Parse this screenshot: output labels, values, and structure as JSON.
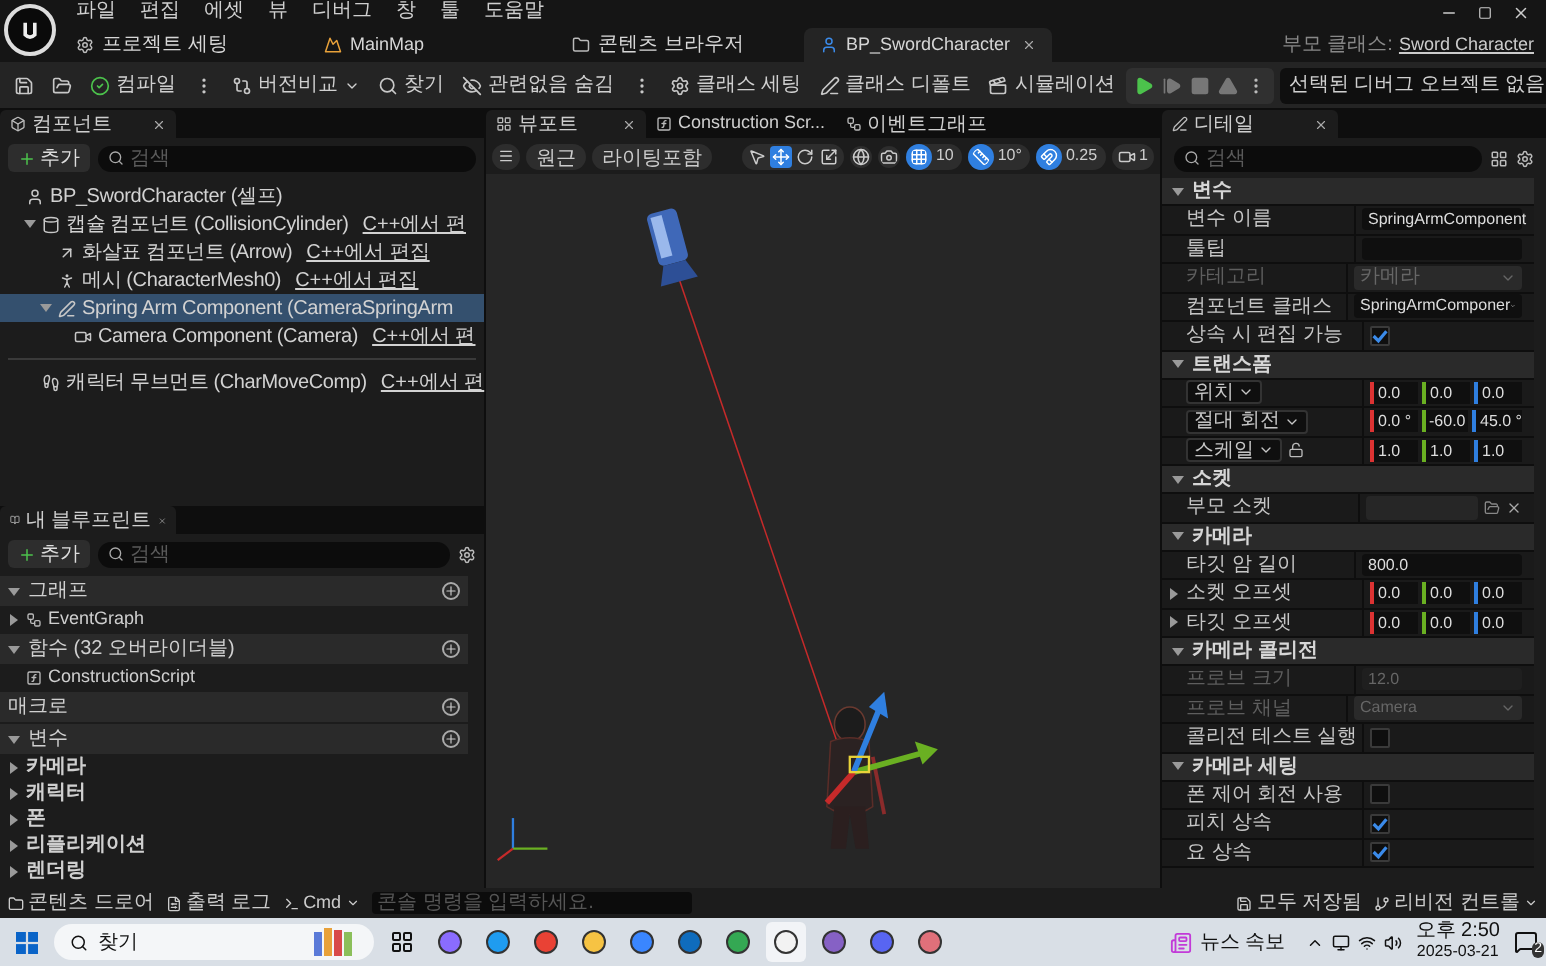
{
  "menu": [
    "파일",
    "편집",
    "에셋",
    "뷰",
    "디버그",
    "창",
    "툴",
    "도움말"
  ],
  "doc_tabs": [
    {
      "label": "프로젝트 세팅",
      "kind": "settings",
      "selected": false,
      "closable": false
    },
    {
      "label": "MainMap",
      "kind": "level",
      "selected": false,
      "closable": false
    },
    {
      "label": "콘텐츠 브라우저",
      "kind": "folder",
      "selected": false,
      "closable": false
    },
    {
      "label": "BP_SwordCharacter",
      "kind": "blueprint",
      "selected": true,
      "closable": true
    }
  ],
  "parent_class": {
    "label": "부모 클래스:",
    "value": "Sword Character"
  },
  "toolbar": [
    {
      "kind": "save"
    },
    {
      "kind": "browse"
    },
    {
      "kind": "compile",
      "label": "컴파일"
    },
    {
      "kind": "more"
    },
    {
      "kind": "diff",
      "label": "버전비교"
    },
    {
      "kind": "find",
      "label": "찾기"
    },
    {
      "kind": "hide",
      "label": "관련없음 숨김"
    },
    {
      "kind": "more"
    },
    {
      "kind": "settings",
      "label": "클래스 세팅"
    },
    {
      "kind": "defaults",
      "label": "클래스 디폴트"
    },
    {
      "kind": "simulate",
      "label": "시뮬레이션"
    }
  ],
  "play_controls": [
    {
      "kind": "play",
      "disabled": false
    },
    {
      "kind": "step",
      "disabled": true
    },
    {
      "kind": "stop",
      "disabled": true
    },
    {
      "kind": "eject",
      "disabled": true
    },
    {
      "kind": "more",
      "disabled": false
    }
  ],
  "debug_object": "선택된 디버그 오브젝트 없음",
  "components": {
    "title": "컴포넌트",
    "add": "추가",
    "search_placeholder": "검색",
    "tree": [
      {
        "label": "BP_SwordCharacter (셀프)",
        "kind": "actor",
        "selected": false,
        "children": [
          {
            "label": "캡슐 컴포넌트 (CollisionCylinder)",
            "link": "C++에서 편",
            "kind": "capsule",
            "selected": false,
            "expanded": true,
            "children": [
              {
                "label": "화살표 컴포넌트 (Arrow)",
                "link": "C++에서 편집",
                "kind": "arrow",
                "selected": false
              },
              {
                "label": "메시 (CharacterMesh0)",
                "link": "C++에서 편집",
                "kind": "mesh",
                "selected": false
              },
              {
                "label": "Spring Arm Component (CameraSpringArm",
                "kind": "springarm",
                "selected": true,
                "expanded": true,
                "children": [
                  {
                    "label": "Camera Component (Camera)",
                    "link": "C++에서 편",
                    "kind": "camera",
                    "selected": false
                  }
                ]
              }
            ]
          }
        ]
      }
    ],
    "after_divider": [
      {
        "label": "캐릭터 무브먼트 (CharMoveComp)",
        "link": "C++에서 편",
        "kind": "movement",
        "selected": false
      }
    ]
  },
  "blueprint": {
    "title": "내 블루프린트",
    "add": "추가",
    "search_placeholder": "검색",
    "sections": [
      {
        "label": "그래프",
        "expanded": true,
        "items": [
          {
            "label": "EventGraph",
            "kind": "graph",
            "expanded": false
          }
        ]
      },
      {
        "label": "함수 (32 오버라이더블)",
        "expanded": true,
        "items": [
          {
            "label": "ConstructionScript",
            "kind": "function"
          }
        ]
      },
      {
        "label": "매크로"
      },
      {
        "label": "변수",
        "expanded": true,
        "items": [
          {
            "label": "카메라",
            "kind": "category",
            "expanded": false
          },
          {
            "label": "캐릭터",
            "kind": "category",
            "expanded": false
          },
          {
            "label": "폰",
            "kind": "category",
            "expanded": false
          },
          {
            "label": "리플리케이션",
            "kind": "category",
            "expanded": false
          },
          {
            "label": "렌더링",
            "kind": "category",
            "expanded": false
          }
        ]
      }
    ]
  },
  "viewport": {
    "tabs": [
      {
        "label": "뷰포트",
        "kind": "viewport",
        "selected": true,
        "closable": true
      },
      {
        "label": "Construction Scr...",
        "kind": "function",
        "selected": false,
        "closable": false
      },
      {
        "label": "이벤트그래프",
        "kind": "graph",
        "selected": false,
        "closable": false
      }
    ],
    "view_mode": "원근",
    "lighting": "라이팅포함",
    "tools": [
      {
        "kind": "select",
        "selected": false
      },
      {
        "kind": "move",
        "selected": true
      },
      {
        "kind": "rotate",
        "selected": false
      },
      {
        "kind": "scale",
        "selected": false
      }
    ],
    "snaps": [
      {
        "kind": "grid",
        "on": true,
        "value": "10"
      },
      {
        "kind": "rotation",
        "on": true,
        "value": "10°"
      },
      {
        "kind": "scale",
        "on": true,
        "value": "0.25"
      }
    ],
    "camera_speed": "1"
  },
  "details": {
    "title": "디테일",
    "search_placeholder": "검색",
    "sections": [
      {
        "label": "변수",
        "expanded": true,
        "rows": [
          {
            "kind": "text",
            "label": "변수 이름",
            "value": "SpringArmComponent",
            "disabled": false
          },
          {
            "kind": "text",
            "label": "툴팁",
            "disabled": false
          },
          {
            "kind": "dropdown",
            "label": "카테고리",
            "value": "카메라",
            "disabled": true
          },
          {
            "kind": "dropdown",
            "label": "컴포넌트 클래스",
            "value": "SpringArmComponer",
            "disabled": false
          },
          {
            "kind": "checkbox",
            "label": "상속 시 편집 가능",
            "checked": true,
            "disabled": false
          }
        ]
      },
      {
        "label": "트랜스폼",
        "expanded": true,
        "rows": [
          {
            "kind": "transform",
            "label": "위치",
            "values": [
              "0.0",
              "0.0",
              "0.0"
            ],
            "disabled": false
          },
          {
            "kind": "transform",
            "label": "절대 회전",
            "values": [
              "0.0 °",
              "-60.0",
              "45.0 °"
            ],
            "disabled": false
          },
          {
            "kind": "transform",
            "label": "스케일",
            "values": [
              "1.0",
              "1.0",
              "1.0"
            ],
            "locked": false,
            "disabled": false
          }
        ]
      },
      {
        "label": "소켓",
        "expanded": true,
        "rows": [
          {
            "kind": "socket",
            "label": "부모 소켓",
            "disabled": false
          }
        ]
      },
      {
        "label": "카메라",
        "expanded": true,
        "rows": [
          {
            "kind": "text",
            "label": "타깃 암 길이",
            "value": "800.0",
            "disabled": false
          },
          {
            "kind": "vector",
            "label": "소켓 오프셋",
            "expanded": false,
            "values": [
              "0.0",
              "0.0",
              "0.0"
            ],
            "disabled": false
          },
          {
            "kind": "vector",
            "label": "타깃 오프셋",
            "expanded": false,
            "values": [
              "0.0",
              "0.0",
              "0.0"
            ],
            "disabled": false
          }
        ]
      },
      {
        "label": "카메라 콜리전",
        "expanded": true,
        "rows": [
          {
            "kind": "text",
            "label": "프로브 크기",
            "value": "12.0",
            "disabled": true
          },
          {
            "kind": "dropdown",
            "label": "프로브 채널",
            "value": "Camera",
            "disabled": true
          },
          {
            "kind": "checkbox",
            "label": "콜리전 테스트 실행",
            "checked": false,
            "disabled": false
          }
        ]
      },
      {
        "label": "카메라 세팅",
        "expanded": true,
        "rows": [
          {
            "kind": "checkbox",
            "label": "폰 제어 회전 사용",
            "checked": false,
            "disabled": false
          },
          {
            "kind": "checkbox",
            "label": "피치 상속",
            "checked": true,
            "disabled": false
          },
          {
            "kind": "checkbox",
            "label": "요 상속",
            "checked": true,
            "disabled": false
          }
        ]
      }
    ]
  },
  "bottom_bar": {
    "content_drawer": "콘텐츠 드로어",
    "output_log": "출력 로그",
    "cmd": "Cmd",
    "console_placeholder": "콘솔 명령을 입력하세요.",
    "save_status": "모두 저장됨",
    "revision": "리비전 컨트롤"
  },
  "taskbar": {
    "search": "찾기",
    "apps": [
      {
        "color": "#8a6cff",
        "active": false
      },
      {
        "color": "#1f9cf0",
        "active": false
      },
      {
        "color": "#e94235",
        "active": false
      },
      {
        "color": "#f6c343",
        "active": false
      },
      {
        "color": "#3a86ff",
        "active": false
      },
      {
        "color": "#0f6cbd",
        "active": false
      },
      {
        "color": "#34a853",
        "active": false
      },
      {
        "color": "#f2f2f2",
        "active": true
      },
      {
        "color": "#8661c5",
        "active": false
      },
      {
        "color": "#5865f2",
        "active": false
      },
      {
        "color": "#e0707a",
        "active": false
      }
    ],
    "news": "뉴스 속보",
    "time": "오후 2:50",
    "date": "2025-03-21",
    "notifications": "2"
  }
}
